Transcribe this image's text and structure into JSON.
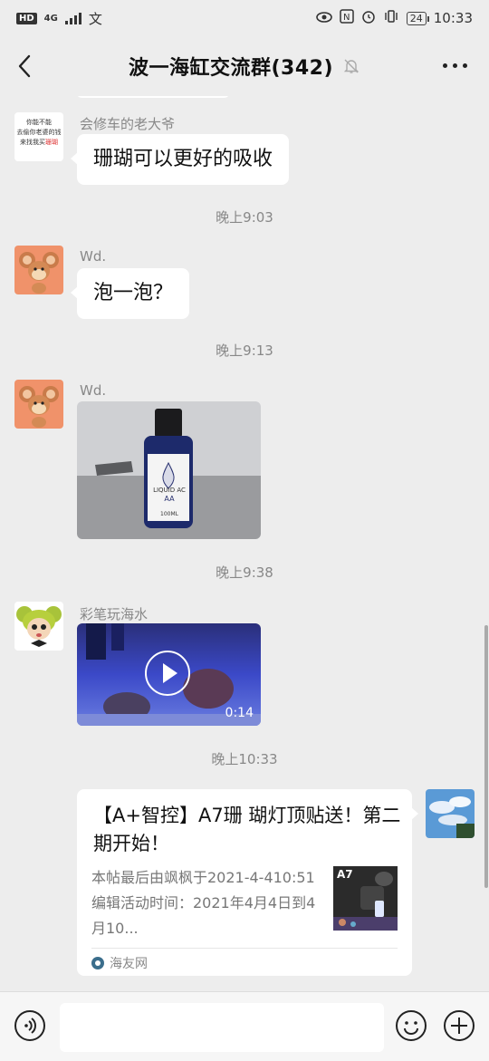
{
  "status_bar": {
    "hd": "HD",
    "network": "4G",
    "ime_indicator": "文",
    "battery": "24",
    "time": "10:33"
  },
  "header": {
    "title": "波一海缸交流群(342)",
    "icons": [
      "back-icon",
      "mute-bell-icon",
      "more-icon"
    ]
  },
  "messages": [
    {
      "sender": "会修车的老大爷",
      "text": "珊瑚可以更好的吸收",
      "avatar_text": [
        "你能不能",
        "去偷你老婆的钱",
        "来找我买",
        "珊瑚"
      ]
    },
    {
      "time": "晚上9:03"
    },
    {
      "sender": "Wd.",
      "text": "泡一泡？"
    },
    {
      "time": "晚上9:13"
    },
    {
      "sender": "Wd.",
      "type": "image",
      "label_text": [
        "LIQUID",
        "AC",
        "AA",
        "100ML"
      ]
    },
    {
      "time": "晚上9:38"
    },
    {
      "sender": "彩笔玩海水",
      "type": "video",
      "duration": "0:14"
    },
    {
      "time": "晚上10:33"
    },
    {
      "type": "link-card",
      "title": "【A+智控】A7珊 瑚灯顶贴送！第二期开始！",
      "description": "本帖最后由飒枫于2021-4-410:51编辑活动时间：2021年4月4日到4月10...",
      "thumb_label": "A7",
      "source": "海友网"
    }
  ],
  "input_bar": {
    "icons": [
      "voice-icon",
      "emoji-icon",
      "plus-icon"
    ],
    "input_value": ""
  },
  "colors": {
    "background": "#ededed",
    "bubble": "#ffffff",
    "meta_text": "#888888"
  }
}
